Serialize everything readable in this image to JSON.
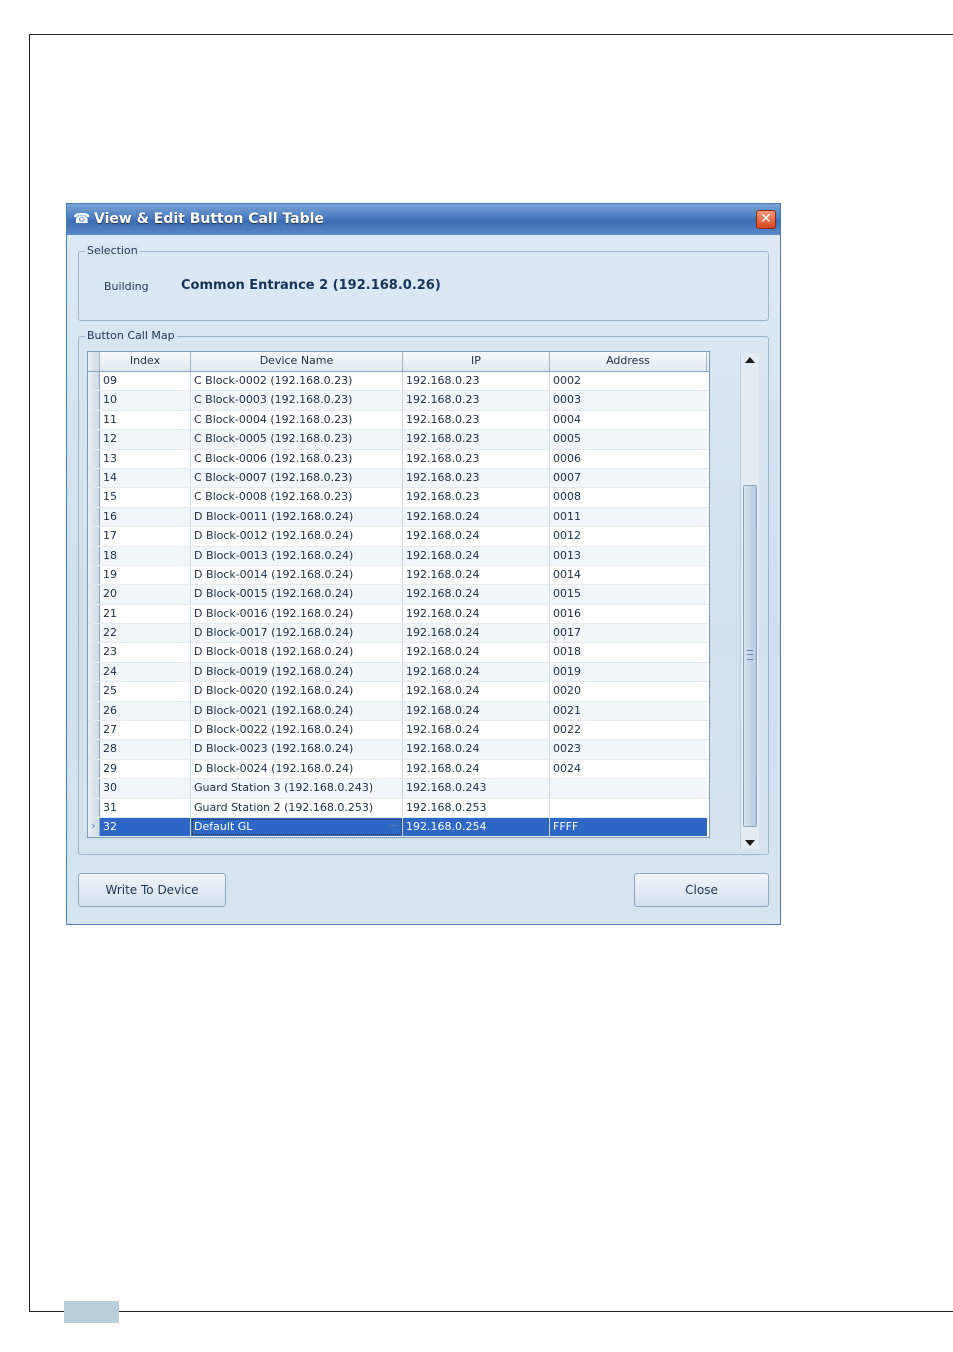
{
  "window": {
    "title": "View & Edit Button Call Table",
    "close_glyph": "✕",
    "icon": "intercom-icon"
  },
  "selection": {
    "legend": "Selection",
    "building_label": "Building",
    "building_value": "Common Entrance 2 (192.168.0.26)"
  },
  "map": {
    "legend": "Button Call Map",
    "columns": [
      "Index",
      "Device Name",
      "IP",
      "Address"
    ],
    "rows": [
      {
        "index": "09",
        "name": "C Block-0002 (192.168.0.23)",
        "ip": "192.168.0.23",
        "address": "0002"
      },
      {
        "index": "10",
        "name": "C Block-0003 (192.168.0.23)",
        "ip": "192.168.0.23",
        "address": "0003"
      },
      {
        "index": "11",
        "name": "C Block-0004 (192.168.0.23)",
        "ip": "192.168.0.23",
        "address": "0004"
      },
      {
        "index": "12",
        "name": "C Block-0005 (192.168.0.23)",
        "ip": "192.168.0.23",
        "address": "0005"
      },
      {
        "index": "13",
        "name": "C Block-0006 (192.168.0.23)",
        "ip": "192.168.0.23",
        "address": "0006"
      },
      {
        "index": "14",
        "name": "C Block-0007 (192.168.0.23)",
        "ip": "192.168.0.23",
        "address": "0007"
      },
      {
        "index": "15",
        "name": "C Block-0008 (192.168.0.23)",
        "ip": "192.168.0.23",
        "address": "0008"
      },
      {
        "index": "16",
        "name": "D Block-0011 (192.168.0.24)",
        "ip": "192.168.0.24",
        "address": "0011"
      },
      {
        "index": "17",
        "name": "D Block-0012 (192.168.0.24)",
        "ip": "192.168.0.24",
        "address": "0012"
      },
      {
        "index": "18",
        "name": "D Block-0013 (192.168.0.24)",
        "ip": "192.168.0.24",
        "address": "0013"
      },
      {
        "index": "19",
        "name": "D Block-0014 (192.168.0.24)",
        "ip": "192.168.0.24",
        "address": "0014"
      },
      {
        "index": "20",
        "name": "D Block-0015 (192.168.0.24)",
        "ip": "192.168.0.24",
        "address": "0015"
      },
      {
        "index": "21",
        "name": "D Block-0016 (192.168.0.24)",
        "ip": "192.168.0.24",
        "address": "0016"
      },
      {
        "index": "22",
        "name": "D Block-0017 (192.168.0.24)",
        "ip": "192.168.0.24",
        "address": "0017"
      },
      {
        "index": "23",
        "name": "D Block-0018 (192.168.0.24)",
        "ip": "192.168.0.24",
        "address": "0018"
      },
      {
        "index": "24",
        "name": "D Block-0019 (192.168.0.24)",
        "ip": "192.168.0.24",
        "address": "0019"
      },
      {
        "index": "25",
        "name": "D Block-0020 (192.168.0.24)",
        "ip": "192.168.0.24",
        "address": "0020"
      },
      {
        "index": "26",
        "name": "D Block-0021 (192.168.0.24)",
        "ip": "192.168.0.24",
        "address": "0021"
      },
      {
        "index": "27",
        "name": "D Block-0022 (192.168.0.24)",
        "ip": "192.168.0.24",
        "address": "0022"
      },
      {
        "index": "28",
        "name": "D Block-0023 (192.168.0.24)",
        "ip": "192.168.0.24",
        "address": "0023"
      },
      {
        "index": "29",
        "name": "D Block-0024 (192.168.0.24)",
        "ip": "192.168.0.24",
        "address": "0024"
      },
      {
        "index": "30",
        "name": "Guard Station 3 (192.168.0.243)",
        "ip": "192.168.0.243",
        "address": ""
      },
      {
        "index": "31",
        "name": "Guard Station 2 (192.168.0.253)",
        "ip": "192.168.0.253",
        "address": ""
      },
      {
        "index": "32",
        "name": "Default GL",
        "ip": "192.168.0.254",
        "address": "FFFF",
        "selected": true
      }
    ],
    "row_pointer": "›",
    "edit_ellipsis": "···"
  },
  "buttons": {
    "write": "Write To Device",
    "close": "Close"
  },
  "colors": {
    "selection": "#2d68c7",
    "titlebar": "#4a7cc0",
    "close": "#d9461f"
  }
}
